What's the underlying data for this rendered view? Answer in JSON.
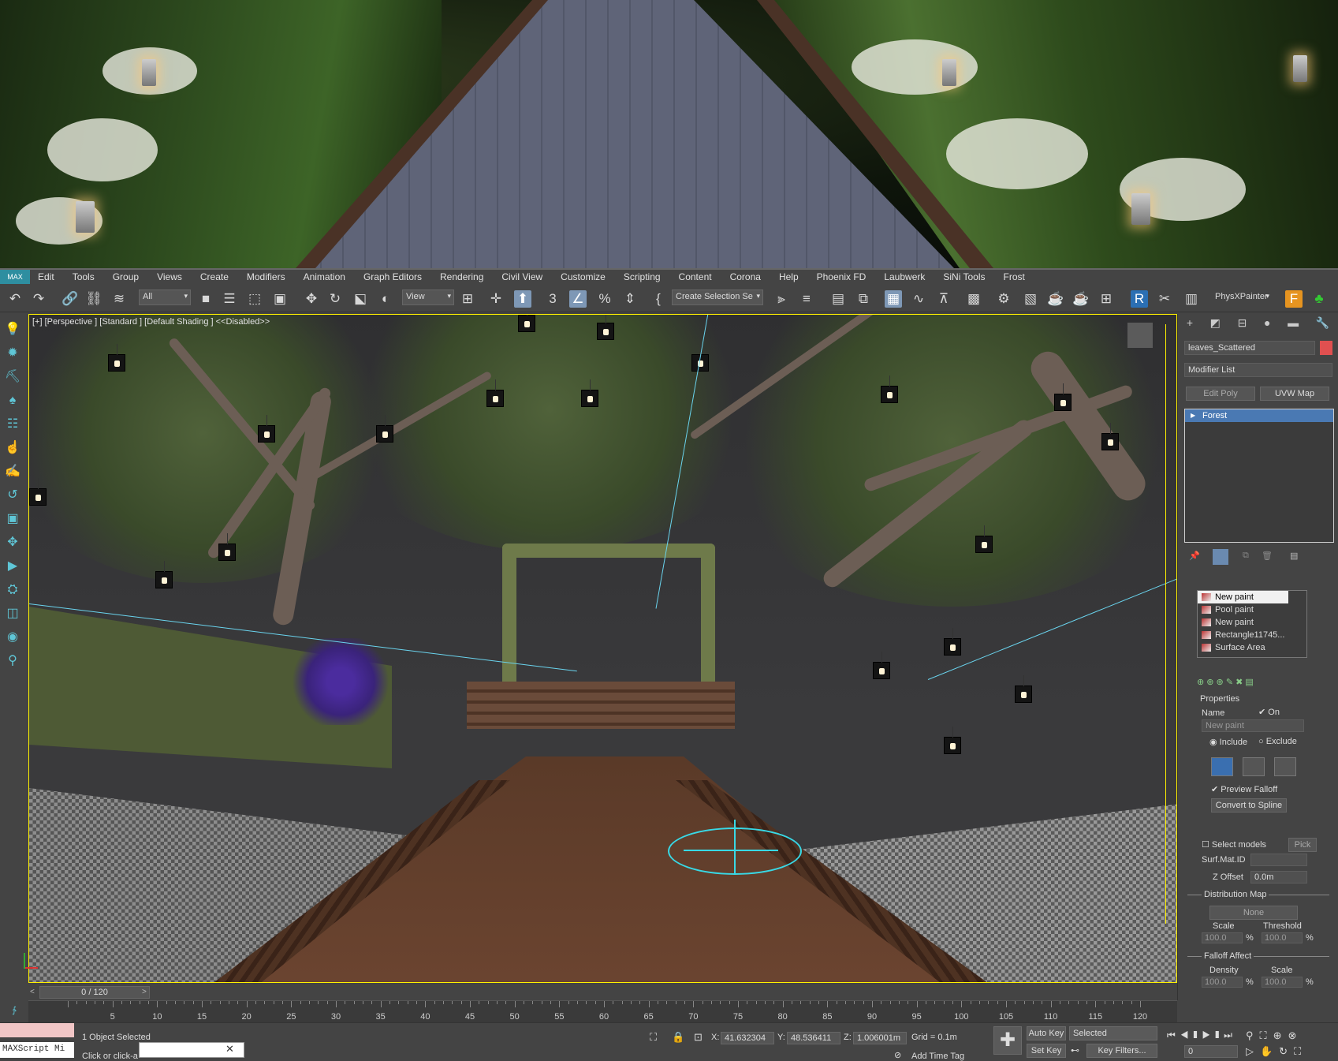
{
  "menu": [
    "Edit",
    "Tools",
    "Group",
    "Views",
    "Create",
    "Modifiers",
    "Animation",
    "Graph Editors",
    "Rendering",
    "Civil View",
    "Customize",
    "Scripting",
    "Content",
    "Corona",
    "Help",
    "Phoenix FD",
    "Laubwerk",
    "SiNi Tools",
    "Frost"
  ],
  "toolbar": {
    "filter_value": "All",
    "ref_coord_value": "View",
    "selection_set_value": "Create Selection Se",
    "physx_label": "PhysXPainter"
  },
  "viewport": {
    "label": "[+] [Perspective ] [Standard ] [Default Shading ]  <<Disabled>>"
  },
  "command_panel": {
    "object_name": "leaves_Scattered",
    "object_color": "#e05050",
    "modifier_list": "Modifier List",
    "buttons": [
      "Edit Poly",
      "UVW Map"
    ],
    "stack": [
      "Forest"
    ],
    "paint_list": [
      "New paint",
      "Pool paint",
      "New paint",
      "Rectangle11745...",
      "Surface Area"
    ],
    "properties_title": "Properties",
    "name_label": "Name",
    "on_label": "On",
    "name_value": "New paint",
    "include_label": "Include",
    "exclude_label": "Exclude",
    "preview_falloff": "Preview Falloff",
    "convert_spline": "Convert to Spline",
    "select_models": "Select models",
    "pick_label": "Pick",
    "surf_mat_id": "Surf.Mat.ID",
    "z_offset_label": "Z Offset",
    "z_offset_value": "0.0m",
    "distribution_map": "Distribution Map",
    "none_label": "None",
    "scale_label": "Scale",
    "threshold_label": "Threshold",
    "scale_value": "100.0",
    "threshold_value": "100.0",
    "percent": "%",
    "falloff_affect": "Falloff Affect",
    "density_label": "Density",
    "scale2_label": "Scale",
    "density_value": "100.0",
    "scale2_value": "100.0"
  },
  "timeline": {
    "slider": "0 / 120",
    "ticks": [
      "5",
      "10",
      "15",
      "20",
      "25",
      "30",
      "35",
      "40",
      "45",
      "50",
      "55",
      "60",
      "65",
      "70",
      "75",
      "80",
      "85",
      "90",
      "95",
      "100",
      "105",
      "110",
      "115",
      "120"
    ]
  },
  "status": {
    "selection": "1 Object Selected",
    "prompt": "Click or click-a",
    "maxscript": "MAXScript Mi",
    "x_label": "X:",
    "x_value": "41.632304",
    "y_label": "Y:",
    "y_value": "48.536411",
    "z_label": "Z:",
    "z_value": "1.006001m",
    "grid": "Grid = 0.1m",
    "add_time_tag": "Add Time Tag",
    "auto_key": "Auto Key",
    "set_key": "Set Key",
    "selected": "Selected",
    "key_filters": "Key Filters...",
    "frame": "0"
  }
}
